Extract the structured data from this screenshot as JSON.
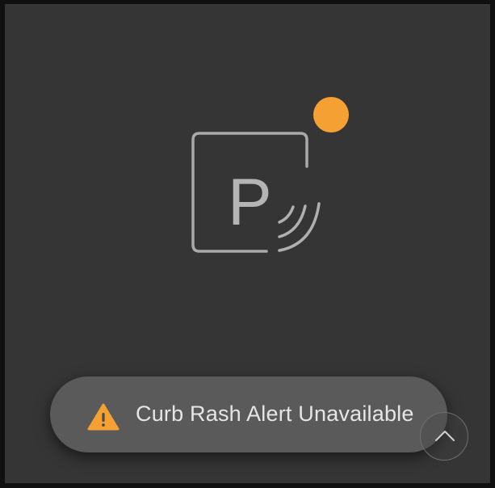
{
  "status": {
    "indicator_color": "#f5a033"
  },
  "parking_sensor": {
    "icon": "parking-sensor-icon",
    "letter": "P"
  },
  "toast": {
    "icon": "warning-icon",
    "icon_color": "#f5a033",
    "message": "Curb Rash Alert Unavailable"
  },
  "expand": {
    "icon": "chevron-up-icon"
  }
}
